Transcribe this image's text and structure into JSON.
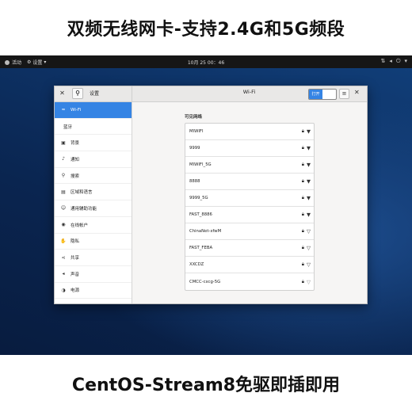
{
  "captions": {
    "top": "双频无线网卡-支持2.4G和5G频段",
    "bottom": "CentOS-Stream8免驱即插即用"
  },
  "top_panel": {
    "activities": "活动",
    "app_menu": "设置",
    "clock": "10月 25 00：46"
  },
  "window": {
    "sidebar_title": "设置",
    "center_title": "Wi-Fi",
    "toggle_label": "打开",
    "section_label": "可见网络"
  },
  "sidebar": {
    "items": [
      {
        "label": "Wi-Fi",
        "icon": "wifi-icon",
        "glyph": "≈"
      },
      {
        "label": "蓝牙",
        "icon": "",
        "glyph": ""
      },
      {
        "label": "背景",
        "icon": "background-icon",
        "glyph": "▣"
      },
      {
        "label": "通知",
        "icon": "bell-icon",
        "glyph": "♪"
      },
      {
        "label": "搜索",
        "icon": "search-icon",
        "glyph": "⚲"
      },
      {
        "label": "区域和语言",
        "icon": "region-icon",
        "glyph": "▤"
      },
      {
        "label": "通用辅助功能",
        "icon": "accessibility-icon",
        "glyph": "☺"
      },
      {
        "label": "在线帐户",
        "icon": "online-accounts-icon",
        "glyph": "◉"
      },
      {
        "label": "隐私",
        "icon": "privacy-icon",
        "glyph": "✋"
      },
      {
        "label": "共享",
        "icon": "share-icon",
        "glyph": "⋖"
      },
      {
        "label": "声音",
        "icon": "sound-icon",
        "glyph": "◂"
      },
      {
        "label": "电源",
        "icon": "power-icon",
        "glyph": "◑"
      },
      {
        "label": "网络",
        "icon": "network-icon",
        "glyph": "▭"
      }
    ]
  },
  "networks": [
    {
      "name": "MIWIFI",
      "signal": "strong"
    },
    {
      "name": "9999",
      "signal": "strong"
    },
    {
      "name": "MIWIFI_5G",
      "signal": "strong"
    },
    {
      "name": "8888",
      "signal": "strong"
    },
    {
      "name": "9999_5G",
      "signal": "strong"
    },
    {
      "name": "FAST_8886",
      "signal": "strong"
    },
    {
      "name": "ChinaNet-xfwM",
      "signal": "medium"
    },
    {
      "name": "FAST_FEBA",
      "signal": "medium"
    },
    {
      "name": "XXCDZ",
      "signal": "medium"
    },
    {
      "name": "CMCC-cxcg-5G",
      "signal": "weak"
    }
  ]
}
